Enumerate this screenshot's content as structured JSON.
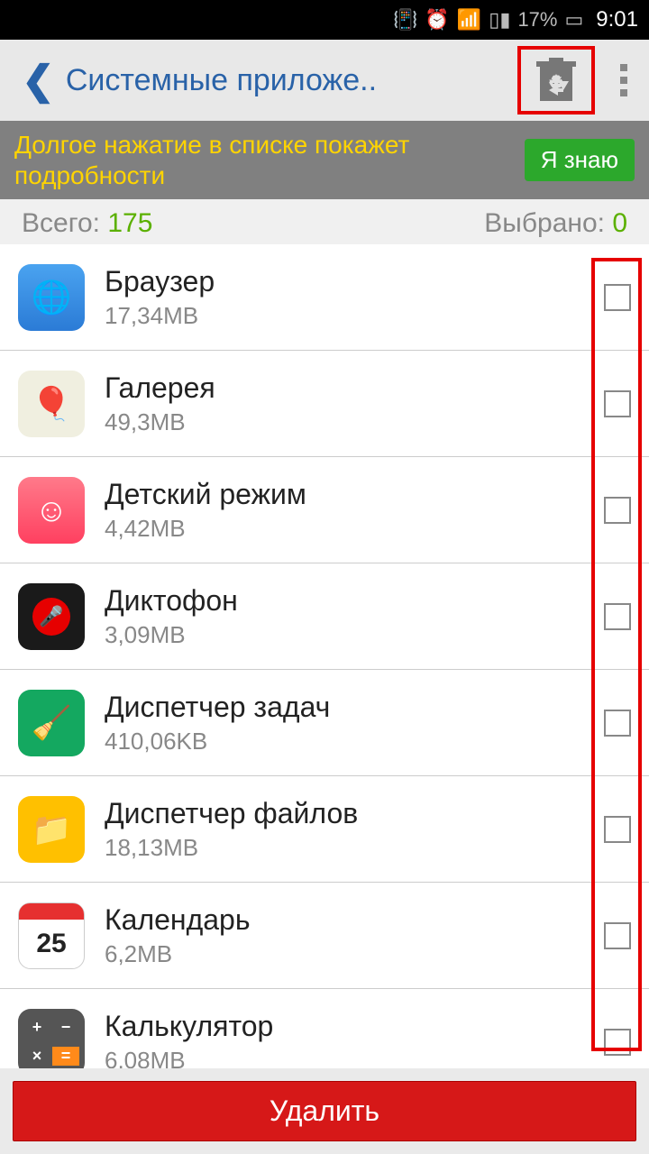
{
  "status": {
    "battery": "17%",
    "time": "9:01"
  },
  "header": {
    "title": "Системные приложе.."
  },
  "hint": {
    "text": "Долгое нажатие в списке покажет подробности",
    "button": "Я знаю"
  },
  "stats": {
    "total_label": "Всего: ",
    "total": "175",
    "selected_label": "Выбрано: ",
    "selected": "0"
  },
  "apps": [
    {
      "name": "Браузер",
      "size": "17,34MB"
    },
    {
      "name": "Галерея",
      "size": "49,3MB"
    },
    {
      "name": "Детский режим",
      "size": "4,42MB"
    },
    {
      "name": "Диктофон",
      "size": "3,09MB"
    },
    {
      "name": "Диспетчер задач",
      "size": "410,06KB"
    },
    {
      "name": "Диспетчер файлов",
      "size": "18,13MB"
    },
    {
      "name": "Календарь",
      "size": "6,2MB"
    },
    {
      "name": "Калькулятор",
      "size": "6,08MB"
    }
  ],
  "calendar_day": "25",
  "footer": {
    "delete": "Удалить"
  }
}
